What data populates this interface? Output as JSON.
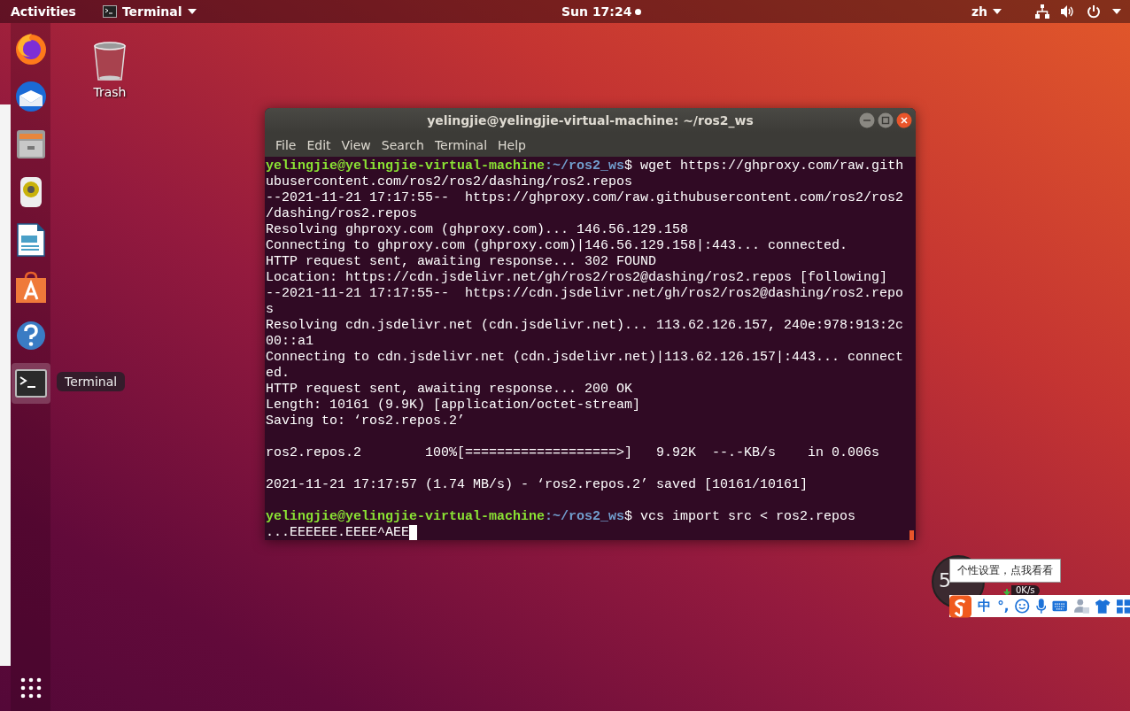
{
  "top_bar": {
    "activities": "Activities",
    "app_menu": "Terminal",
    "clock": "Sun 17:24",
    "input_method": "zh"
  },
  "dock": [
    {
      "kind": "firefox",
      "selected": false
    },
    {
      "kind": "thunderbird",
      "selected": false
    },
    {
      "kind": "files",
      "selected": false
    },
    {
      "kind": "rhythmbox",
      "selected": false
    },
    {
      "kind": "writer",
      "selected": false
    },
    {
      "kind": "software",
      "selected": false
    },
    {
      "kind": "help",
      "selected": false
    },
    {
      "kind": "terminal",
      "selected": true
    }
  ],
  "dock_tooltip": "Terminal",
  "desktop_icons": [
    {
      "label": "Trash"
    }
  ],
  "terminal": {
    "title": "yelingjie@yelingjie-virtual-machine: ~/ros2_ws",
    "menu": [
      "File",
      "Edit",
      "View",
      "Search",
      "Terminal",
      "Help"
    ],
    "lines": [
      {
        "kind": "prompt",
        "user": "yelingjie@yelingjie-virtual-machine",
        "path": ":~/ros2_ws",
        "sign": "$",
        "command": " wget https://ghproxy.com/raw.gith"
      },
      {
        "kind": "output",
        "text": "ubusercontent.com/ros2/ros2/dashing/ros2.repos"
      },
      {
        "kind": "output",
        "text": "--2021-11-21 17:17:55--  https://ghproxy.com/raw.githubusercontent.com/ros2/ros2"
      },
      {
        "kind": "output",
        "text": "/dashing/ros2.repos"
      },
      {
        "kind": "output",
        "text": "Resolving ghproxy.com (ghproxy.com)... 146.56.129.158"
      },
      {
        "kind": "output",
        "text": "Connecting to ghproxy.com (ghproxy.com)|146.56.129.158|:443... connected."
      },
      {
        "kind": "output",
        "text": "HTTP request sent, awaiting response... 302 FOUND"
      },
      {
        "kind": "output",
        "text": "Location: https://cdn.jsdelivr.net/gh/ros2/ros2@dashing/ros2.repos [following]"
      },
      {
        "kind": "output",
        "text": "--2021-11-21 17:17:55--  https://cdn.jsdelivr.net/gh/ros2/ros2@dashing/ros2.repo"
      },
      {
        "kind": "output",
        "text": "s"
      },
      {
        "kind": "output",
        "text": "Resolving cdn.jsdelivr.net (cdn.jsdelivr.net)... 113.62.126.157, 240e:978:913:2c"
      },
      {
        "kind": "output",
        "text": "00::a1"
      },
      {
        "kind": "output",
        "text": "Connecting to cdn.jsdelivr.net (cdn.jsdelivr.net)|113.62.126.157|:443... connect"
      },
      {
        "kind": "output",
        "text": "ed."
      },
      {
        "kind": "output",
        "text": "HTTP request sent, awaiting response... 200 OK"
      },
      {
        "kind": "output",
        "text": "Length: 10161 (9.9K) [application/octet-stream]"
      },
      {
        "kind": "output",
        "text": "Saving to: ‘ros2.repos.2’"
      },
      {
        "kind": "blank"
      },
      {
        "kind": "output",
        "text": "ros2.repos.2        100%[===================>]   9.92K  --.-KB/s    in 0.006s"
      },
      {
        "kind": "blank"
      },
      {
        "kind": "output",
        "text": "2021-11-21 17:17:57 (1.74 MB/s) - ‘ros2.repos.2’ saved [10161/10161]"
      },
      {
        "kind": "blank"
      },
      {
        "kind": "prompt",
        "user": "yelingjie@yelingjie-virtual-machine",
        "path": ":~/ros2_ws",
        "sign": "$",
        "command": " vcs import src < ros2.repos"
      },
      {
        "kind": "cursor",
        "text": "...EEEEEE.EEEE^AEE"
      }
    ]
  },
  "ime": {
    "meter_value": "5",
    "speed": "0K/s",
    "tooltip": "个性设置，点我看看",
    "mode": "中",
    "punctuation": "°,"
  }
}
